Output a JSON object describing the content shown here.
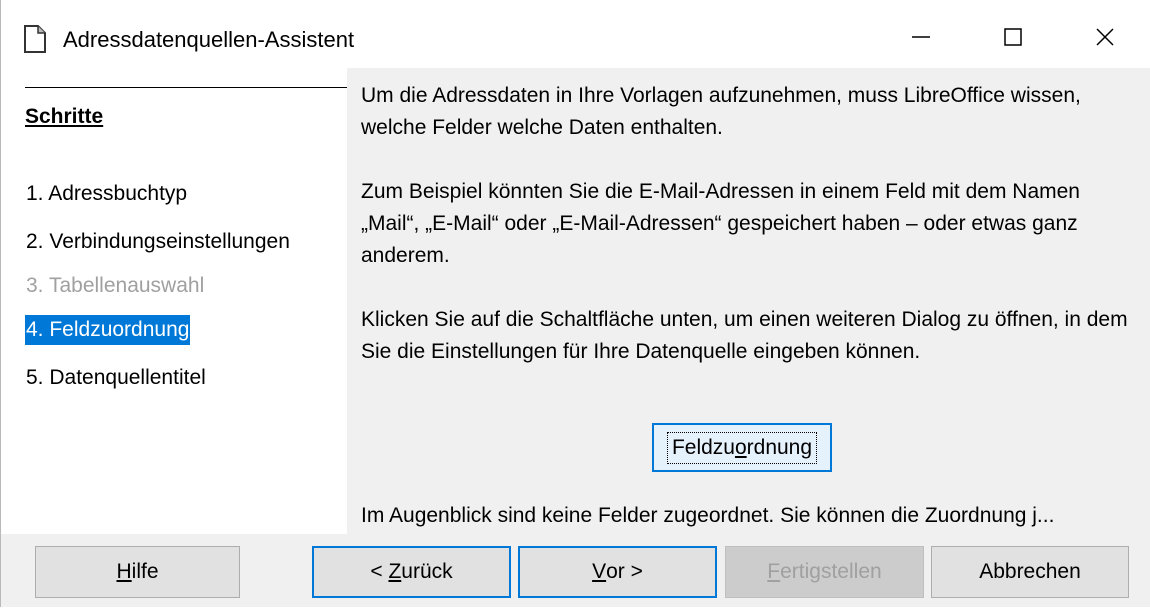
{
  "window": {
    "title": "Adressdatenquellen-Assistent",
    "icons": {
      "app": "document-icon",
      "minimize": "minimize-icon",
      "maximize": "maximize-icon",
      "close": "close-icon"
    }
  },
  "sidebar": {
    "heading": "Schritte",
    "steps": [
      {
        "label": "1. Adressbuchtyp",
        "state": "normal"
      },
      {
        "label": "2. Verbindungseinstellungen",
        "state": "normal"
      },
      {
        "label": "3. Tabellenauswahl",
        "state": "disabled"
      },
      {
        "label": "4. Feldzuordnung",
        "state": "current"
      },
      {
        "label": "5. Datenquellentitel",
        "state": "normal"
      }
    ]
  },
  "main": {
    "paragraph1": "Um die Adressdaten in Ihre Vorlagen aufzunehmen, muss LibreOffice wissen, welche Felder welche Daten enthalten.",
    "paragraph2": "Zum Beispiel könnten Sie die E-Mail-Adressen in einem Feld mit dem Namen „Mail“, „E-Mail“ oder „E-Mail-Adressen“ gespeichert haben – oder etwas ganz anderem.",
    "paragraph3": "Klicken Sie auf die Schaltfläche unten, um einen weiteren Dialog zu öffnen, in dem Sie die Einstellungen für Ihre Datenquelle eingeben können.",
    "field_mapping_button": {
      "before": "Feldzu",
      "mnemonic": "o",
      "after": "rdnung"
    },
    "status": "Im Augenblick sind keine Felder zugeordnet. Sie können die Zuordnung j..."
  },
  "buttons": {
    "help": {
      "mnemonic": "H",
      "rest": "ilfe"
    },
    "back": {
      "before": "< ",
      "mnemonic": "Z",
      "rest": "urück"
    },
    "next": {
      "mnemonic": "V",
      "rest": "or >"
    },
    "finish": {
      "mnemonic": "F",
      "rest": "ertigstellen"
    },
    "cancel": "Abbrechen"
  },
  "colors": {
    "accent": "#0078d7",
    "dialog_bg": "#f0f0f0",
    "disabled_text": "#a0a0a0"
  }
}
